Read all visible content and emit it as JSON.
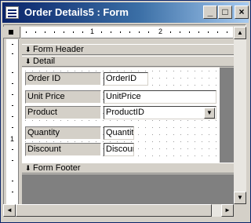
{
  "window": {
    "title": "Order Details5 : Form",
    "minimize_glyph": "_",
    "maximize_glyph": "□",
    "close_glyph": "×"
  },
  "ruler": {
    "h_numbers": [
      "1",
      "2"
    ],
    "v_numbers": [
      "1"
    ]
  },
  "sections": {
    "header": "Form Header",
    "detail": "Detail",
    "footer": "Form Footer",
    "arrow_glyph": "⬇"
  },
  "fields": [
    {
      "label": "Order ID",
      "control": "OrderID"
    },
    {
      "label": "Unit Price",
      "control": "UnitPrice"
    },
    {
      "label": "Product",
      "control": "ProductID"
    },
    {
      "label": "Quantity",
      "control": "Quantity"
    },
    {
      "label": "Discount",
      "control": "Discour"
    }
  ],
  "combo_glyph": "▼",
  "scroll_glyphs": {
    "up": "▲",
    "down": "▼",
    "left": "◄",
    "right": "►"
  },
  "colors": {
    "titlebar_start": "#0a246a",
    "titlebar_end": "#a6caf0",
    "face": "#d4d0c8"
  }
}
